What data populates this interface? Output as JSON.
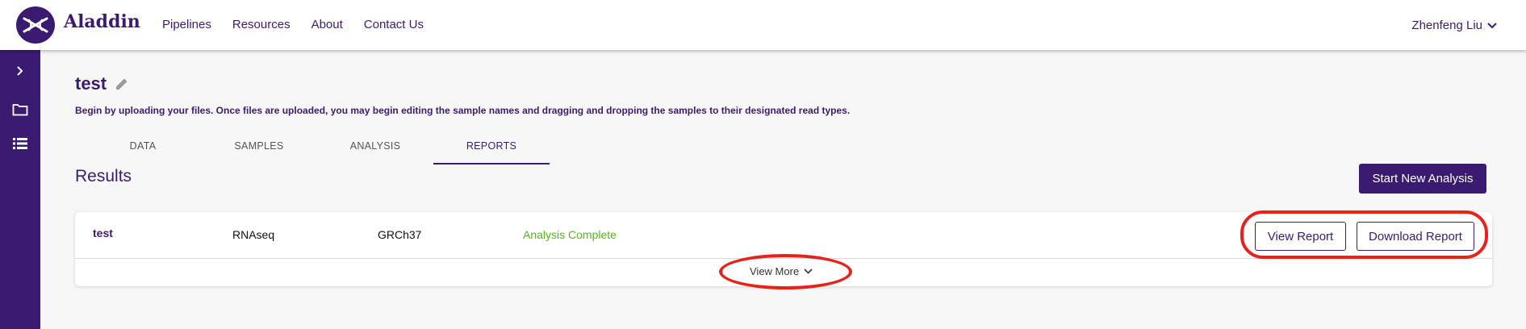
{
  "header": {
    "brand": "Aladdin",
    "nav": [
      "Pipelines",
      "Resources",
      "About",
      "Contact Us"
    ],
    "user": "Zhenfeng Liu"
  },
  "sidebar": {
    "icons": [
      "chevron-right-icon",
      "folder-icon",
      "list-icon"
    ],
    "background": "#3b1b72"
  },
  "project": {
    "title": "test",
    "description": "Begin by uploading your files. Once files are uploaded, you may begin editing the sample names and dragging and dropping the samples to their designated read types."
  },
  "tabs": [
    {
      "label": "DATA",
      "active": false
    },
    {
      "label": "SAMPLES",
      "active": false
    },
    {
      "label": "ANALYSIS",
      "active": false
    },
    {
      "label": "REPORTS",
      "active": true
    }
  ],
  "results": {
    "title": "Results",
    "start_button": "Start New Analysis",
    "row": {
      "name": "test",
      "type": "RNAseq",
      "reference": "GRCh37",
      "status": "Analysis Complete"
    },
    "view_report": "View Report",
    "download_report": "Download Report",
    "view_more": "View More"
  },
  "colors": {
    "accent": "#3b1b72",
    "status_complete": "#54b817",
    "highlight_ring": "#e8221b"
  }
}
